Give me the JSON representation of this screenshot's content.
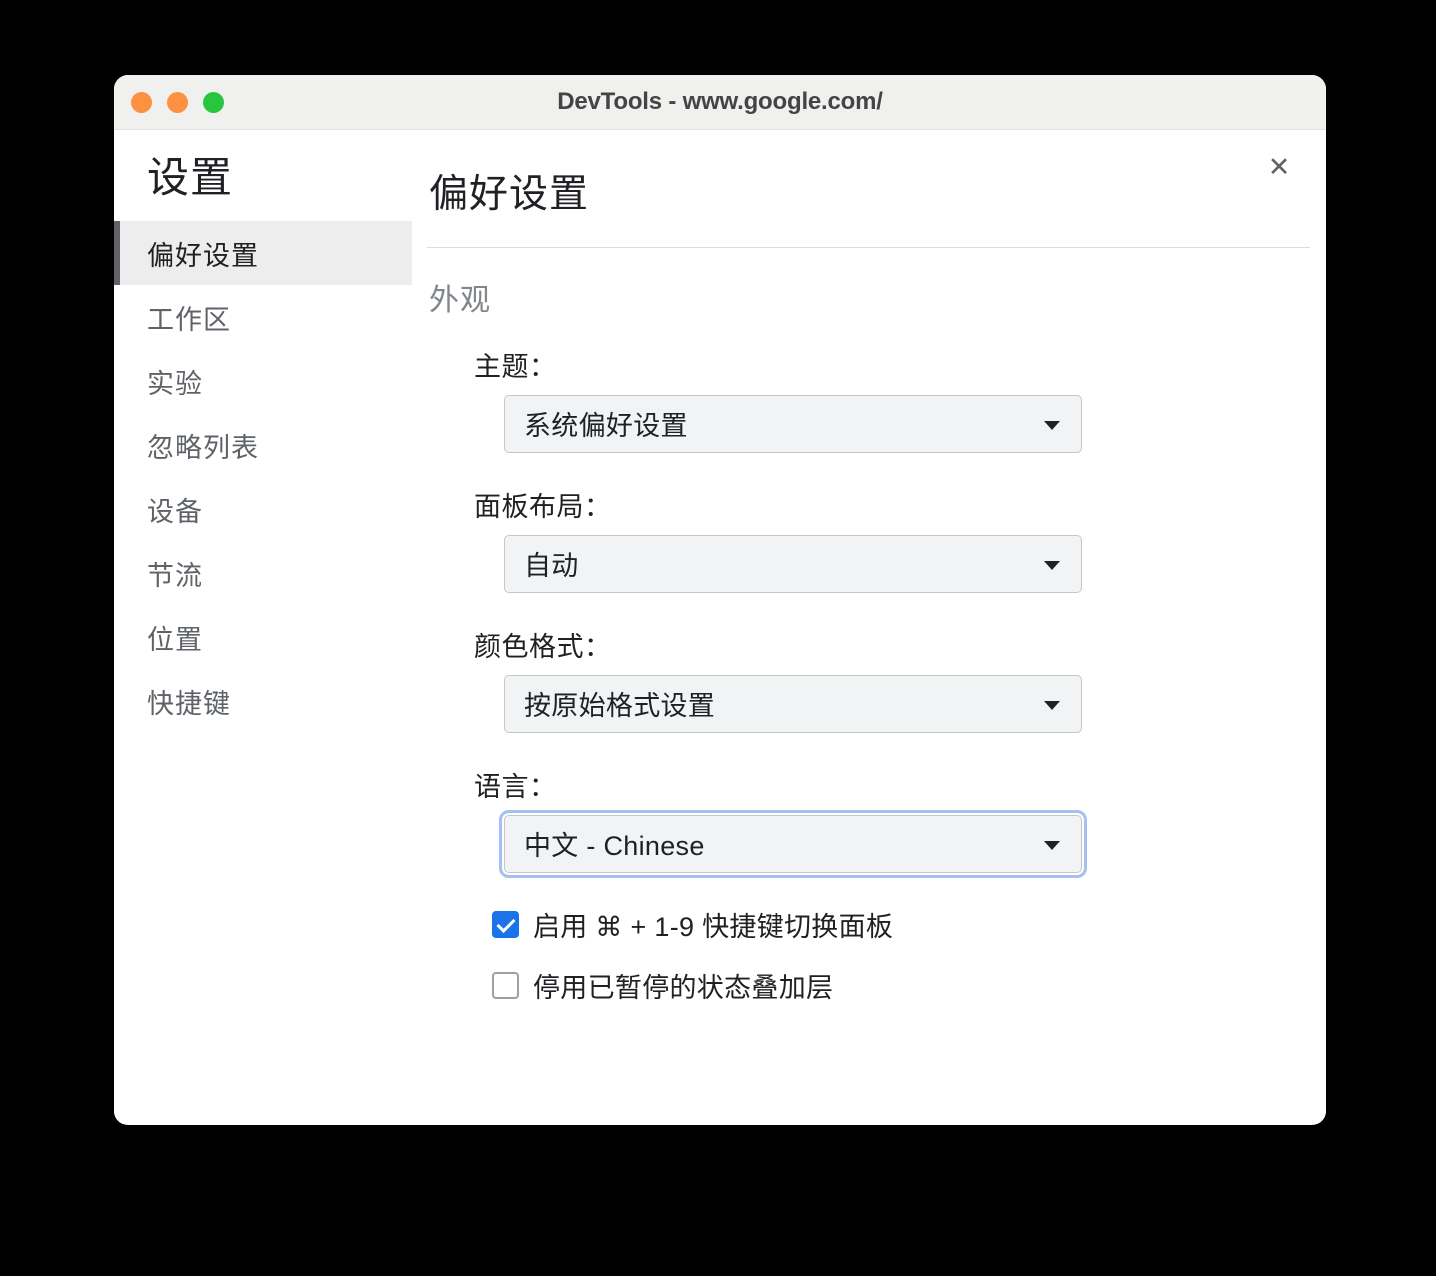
{
  "window": {
    "title": "DevTools - www.google.com/",
    "traffic_lights": [
      {
        "name": "close",
        "color": "#fb9141"
      },
      {
        "name": "minimize",
        "color": "#fb9141"
      },
      {
        "name": "zoom",
        "color": "#28c63f"
      }
    ]
  },
  "sidebar": {
    "title": "设置",
    "items": [
      {
        "label": "偏好设置",
        "selected": true
      },
      {
        "label": "工作区",
        "selected": false
      },
      {
        "label": "实验",
        "selected": false
      },
      {
        "label": "忽略列表",
        "selected": false
      },
      {
        "label": "设备",
        "selected": false
      },
      {
        "label": "节流",
        "selected": false
      },
      {
        "label": "位置",
        "selected": false
      },
      {
        "label": "快捷键",
        "selected": false
      }
    ]
  },
  "main": {
    "title": "偏好设置",
    "close_label": "✕",
    "section_title": "外观",
    "fields": [
      {
        "label": "主题：",
        "value": "系统偏好设置",
        "focused": false
      },
      {
        "label": "面板布局：",
        "value": "自动",
        "focused": false
      },
      {
        "label": "颜色格式：",
        "value": "按原始格式设置",
        "focused": false
      },
      {
        "label": "语言：",
        "value": "中文 - Chinese",
        "focused": true
      }
    ],
    "checkboxes": [
      {
        "label": "启用 ⌘ + 1-9 快捷键切换面板",
        "checked": true
      },
      {
        "label": "停用已暂停的状态叠加层",
        "checked": false
      }
    ]
  },
  "colors": {
    "accent": "#1a73e8",
    "focus_ring": "#a3c0f0",
    "sidebar_selected_bg": "#ededed",
    "sidebar_selected_bar": "#5f6368",
    "select_bg": "#f1f3f4",
    "select_border": "#c4c7c5",
    "titlebar_bg": "#f0f0ef",
    "page_bg": "#000000"
  }
}
